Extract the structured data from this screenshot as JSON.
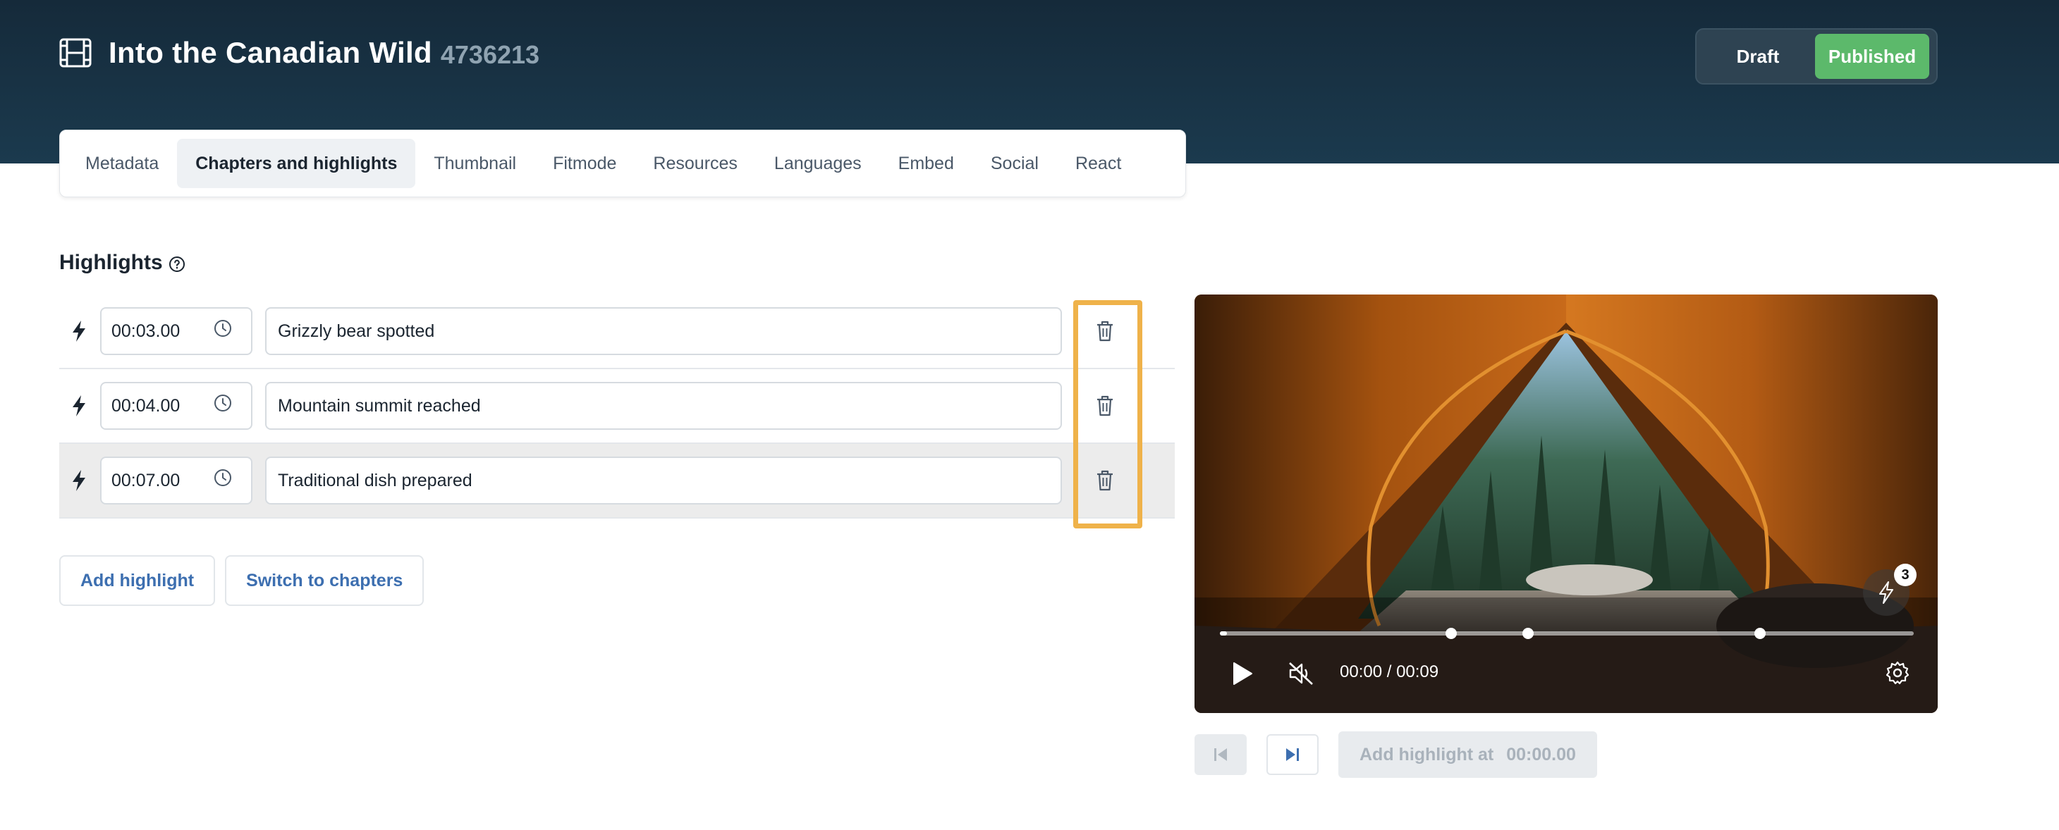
{
  "header": {
    "title": "Into the Canadian Wild",
    "id": "4736213",
    "status": {
      "draft_label": "Draft",
      "published_label": "Published",
      "selected": "Published",
      "accent": "#5cb96b"
    }
  },
  "tabs": [
    {
      "label": "Metadata",
      "active": false
    },
    {
      "label": "Chapters and highlights",
      "active": true
    },
    {
      "label": "Thumbnail",
      "active": false
    },
    {
      "label": "Fitmode",
      "active": false
    },
    {
      "label": "Resources",
      "active": false
    },
    {
      "label": "Languages",
      "active": false
    },
    {
      "label": "Embed",
      "active": false
    },
    {
      "label": "Social",
      "active": false
    },
    {
      "label": "React",
      "active": false
    }
  ],
  "highlights": {
    "title": "Highlights",
    "items": [
      {
        "time": "00:03.00",
        "title": "Grizzly bear spotted"
      },
      {
        "time": "00:04.00",
        "title": "Mountain summit reached"
      },
      {
        "time": "00:07.00",
        "title": "Traditional dish prepared"
      }
    ],
    "add_label": "Add highlight",
    "switch_label": "Switch to chapters"
  },
  "player": {
    "time_display": "00:00 / 00:09",
    "highlight_count": "3",
    "progress_fraction": 0.01,
    "marker_fractions": [
      0.333,
      0.444,
      0.778
    ]
  },
  "below_player": {
    "add_at_label": "Add highlight at",
    "add_at_time": "00:00.00"
  },
  "icons": {
    "title": "film-icon",
    "help": "help-circle-icon",
    "row_type": "bolt-icon",
    "time": "clock-icon",
    "delete": "trash-icon",
    "play": "play-icon",
    "mute": "mute-icon",
    "settings": "gear-icon",
    "prev": "skip-previous-icon",
    "next": "skip-next-icon"
  }
}
